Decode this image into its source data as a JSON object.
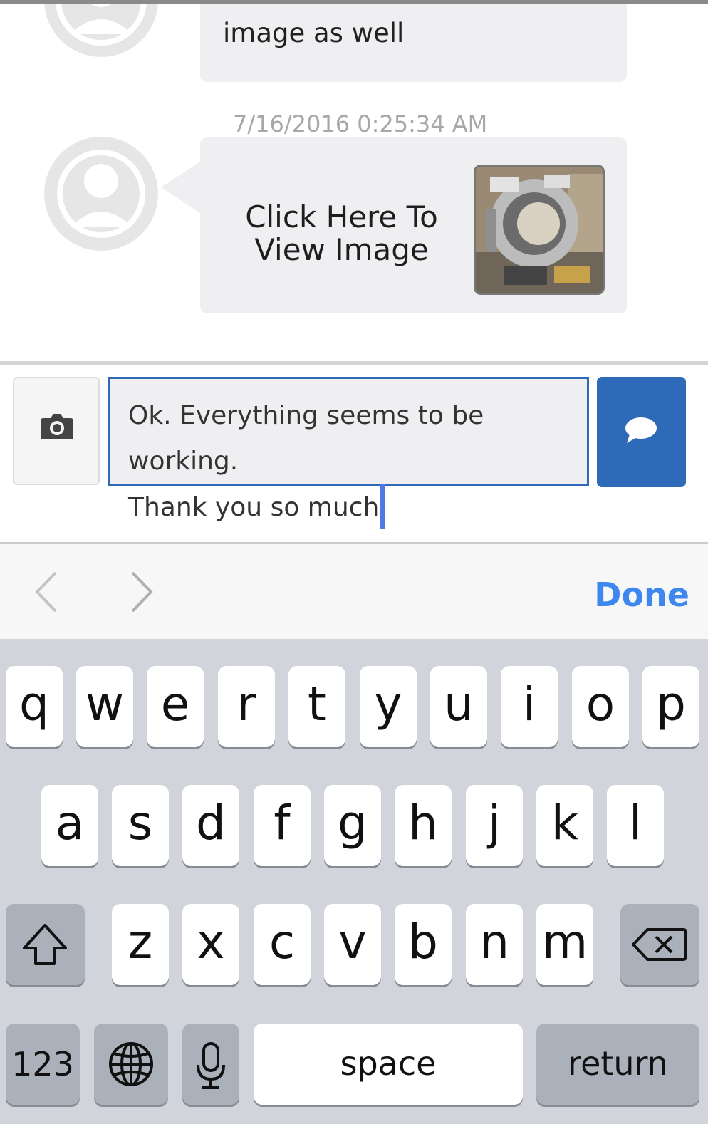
{
  "messages": [
    {
      "text": "image as well"
    },
    {
      "timestamp": "7/16/2016 0:25:34 AM",
      "image_link_label_line1": "Click Here To",
      "image_link_label_line2": "View Image"
    }
  ],
  "composer": {
    "input_line1": "Ok. Everything seems to be working.",
    "input_line2": "Thank you so much",
    "accent_color": "#2f6ab9"
  },
  "accessory_bar": {
    "done_label": "Done"
  },
  "keyboard": {
    "row1": [
      "q",
      "w",
      "e",
      "r",
      "t",
      "y",
      "u",
      "i",
      "o",
      "p"
    ],
    "row2": [
      "a",
      "s",
      "d",
      "f",
      "g",
      "h",
      "j",
      "k",
      "l"
    ],
    "row3": [
      "z",
      "x",
      "c",
      "v",
      "b",
      "n",
      "m"
    ],
    "numbers_label": "123",
    "space_label": "space",
    "return_label": "return"
  }
}
